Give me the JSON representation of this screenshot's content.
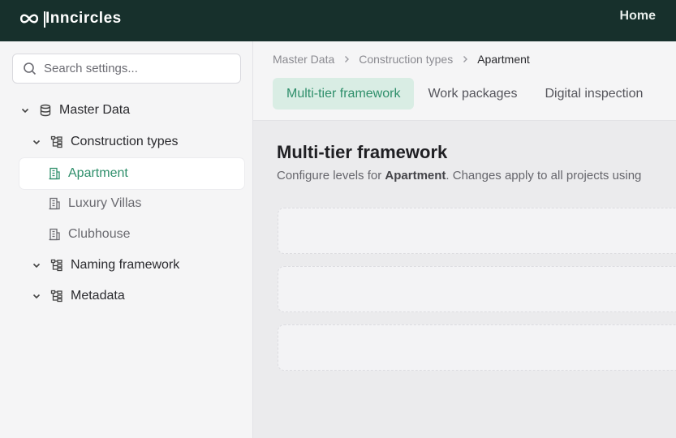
{
  "app": {
    "brand": "Inncircles",
    "nav_home": "Home"
  },
  "sidebar": {
    "search_placeholder": "Search settings...",
    "tree": {
      "root": {
        "label": "Master Data",
        "icon": "database-icon"
      },
      "construction_types": {
        "label": "Construction types",
        "icon": "tree-structure-icon",
        "items": [
          {
            "label": "Apartment",
            "icon": "building-icon",
            "active": true
          },
          {
            "label": "Luxury Villas",
            "icon": "building-icon",
            "active": false
          },
          {
            "label": "Clubhouse",
            "icon": "building-icon",
            "active": false
          }
        ]
      },
      "naming_framework": {
        "label": "Naming framework",
        "icon": "tree-structure-icon"
      },
      "metadata": {
        "label": "Metadata",
        "icon": "tree-structure-icon"
      }
    }
  },
  "main": {
    "breadcrumb": [
      "Master Data",
      "Construction types",
      "Apartment"
    ],
    "tabs": [
      {
        "label": "Multi-tier framework",
        "active": true
      },
      {
        "label": "Work packages",
        "active": false
      },
      {
        "label": "Digital inspection",
        "active": false
      }
    ],
    "title": "Multi-tier framework",
    "description": {
      "prefix": "Configure levels for ",
      "entity": "Apartment",
      "suffix": ". Changes apply to all projects using"
    },
    "level_cards": 3
  },
  "colors": {
    "topbar": "#17302c",
    "accent": "#2f8f6b",
    "accent_bg": "#d9ede4",
    "sidebar_bg": "#f5f5f6",
    "content_bg": "#ebebed"
  }
}
